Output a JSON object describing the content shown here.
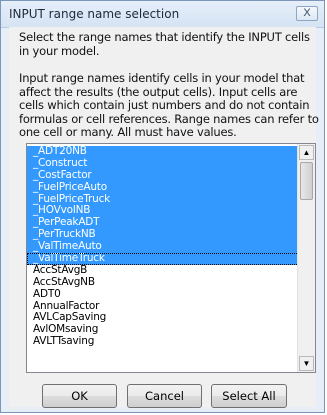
{
  "window": {
    "title": "INPUT range name selection",
    "close_glyph": "X"
  },
  "instructions": {
    "line1": "Select the range names that identify the INPUT cells in your model.",
    "line2": "Input range names identify cells in your model that affect the results (the output cells).  Input cells are cells which contain just numbers and do not contain formulas or cell references.  Range names can refer to one cell or many.  All must have values."
  },
  "list": {
    "items": [
      {
        "label": "_ADT20NB",
        "selected": true
      },
      {
        "label": "_Construct",
        "selected": true
      },
      {
        "label": "_CostFactor",
        "selected": true
      },
      {
        "label": "_FuelPriceAuto",
        "selected": true
      },
      {
        "label": "_FuelPriceTruck",
        "selected": true
      },
      {
        "label": "_HOVvolNB",
        "selected": true
      },
      {
        "label": "_PerPeakADT",
        "selected": true
      },
      {
        "label": "_PerTruckNB",
        "selected": true
      },
      {
        "label": "_ValTimeAuto",
        "selected": true
      },
      {
        "label": "_ValTimeTruck",
        "selected": true,
        "focused": true
      },
      {
        "label": "AccStAvgB",
        "selected": false
      },
      {
        "label": "AccStAvgNB",
        "selected": false
      },
      {
        "label": "ADT0",
        "selected": false
      },
      {
        "label": "AnnualFactor",
        "selected": false
      },
      {
        "label": "AVLCapSaving",
        "selected": false
      },
      {
        "label": "AvlOMsaving",
        "selected": false
      },
      {
        "label": "AVLTTsaving",
        "selected": false
      }
    ],
    "selection_color": "#3399ff",
    "scroll_up_icon": "▲",
    "scroll_down_icon": "▼"
  },
  "buttons": {
    "ok_label": "OK",
    "cancel_label": "Cancel",
    "select_all_label": "Select All"
  }
}
